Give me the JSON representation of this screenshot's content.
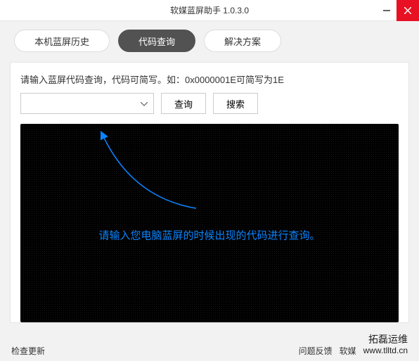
{
  "titlebar": {
    "title": "软媒蓝屏助手 1.0.3.0"
  },
  "tabs": {
    "history": "本机蓝屏历史",
    "query": "代码查询",
    "solution": "解决方案"
  },
  "panel": {
    "hint": "请输入蓝屏代码查询，代码可简写。如：0x0000001E可简写为1E",
    "combo_value": "",
    "query_btn": "查询",
    "search_btn": "搜索"
  },
  "result": {
    "message": "请输入您电脑蓝屏的时候出现的代码进行查询。"
  },
  "footer": {
    "check_update": "检查更新",
    "feedback": "问题反馈",
    "softname": "软媒"
  },
  "watermark": {
    "title": "拓磊运维",
    "url": "www.tlltd.cn"
  }
}
